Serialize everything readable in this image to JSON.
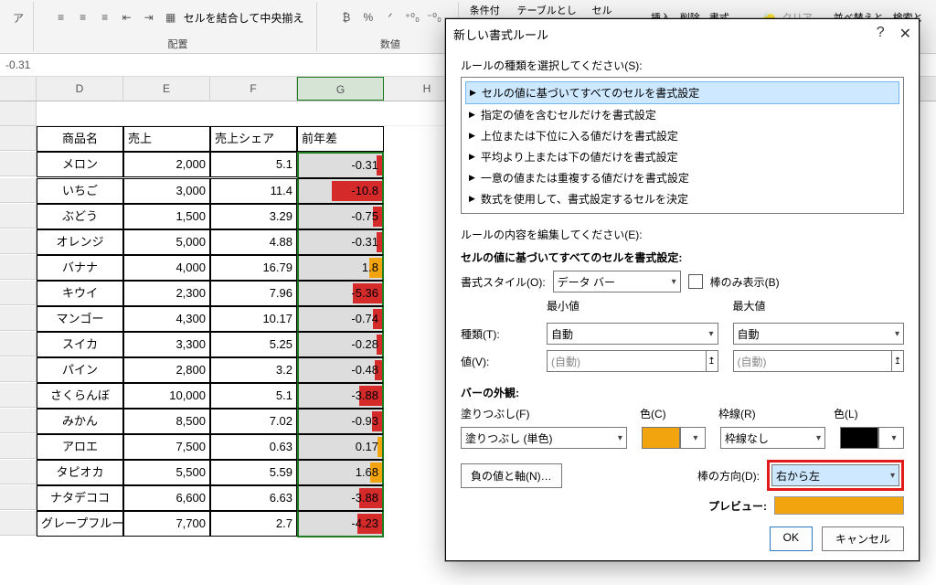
{
  "ribbon": {
    "merge_label": "セルを結合して中央揃え",
    "group_align": "配置",
    "group_number": "数値",
    "percent": "%",
    "comma": "ᐟ",
    "inc_dec": "⁺⁰₀",
    "dec_dec": "⁻⁰₀",
    "cond": "条件付き",
    "tablefmt": "テーブルとして",
    "cellstyle": "セルの",
    "insert": "挿入",
    "delete": "削除",
    "format": "書式",
    "clear": "クリア",
    "sort": "並べ替えと",
    "find": "検索と"
  },
  "formula": "-0.31",
  "columns": {
    "D": "D",
    "E": "E",
    "F": "F",
    "G": "G",
    "H": "H"
  },
  "headers": {
    "name": "商品名",
    "sales": "売上",
    "share": "売上シェア",
    "diff": "前年差"
  },
  "rows": [
    {
      "n": "メロン",
      "s": "2,000",
      "sh": "5.1",
      "d": "-0.31",
      "bw": 6,
      "cls": "red"
    },
    {
      "n": "いちご",
      "s": "3,000",
      "sh": "11.4",
      "d": "-10.8",
      "bw": 55,
      "cls": "red"
    },
    {
      "n": "ぶどう",
      "s": "1,500",
      "sh": "3.29",
      "d": "-0.75",
      "bw": 10,
      "cls": "red"
    },
    {
      "n": "オレンジ",
      "s": "5,000",
      "sh": "4.88",
      "d": "-0.31",
      "bw": 6,
      "cls": "red"
    },
    {
      "n": "バナナ",
      "s": "4,000",
      "sh": "16.79",
      "d": "1.8",
      "bw": 14,
      "cls": "org"
    },
    {
      "n": "キウイ",
      "s": "2,300",
      "sh": "7.96",
      "d": "-5.36",
      "bw": 32,
      "cls": "red"
    },
    {
      "n": "マンゴー",
      "s": "4,300",
      "sh": "10.17",
      "d": "-0.74",
      "bw": 10,
      "cls": "red"
    },
    {
      "n": "スイカ",
      "s": "3,300",
      "sh": "5.25",
      "d": "-0.28",
      "bw": 6,
      "cls": "red"
    },
    {
      "n": "パイン",
      "s": "2,800",
      "sh": "3.2",
      "d": "-0.48",
      "bw": 8,
      "cls": "red"
    },
    {
      "n": "さくらんぼ",
      "s": "10,000",
      "sh": "5.1",
      "d": "-3.88",
      "bw": 25,
      "cls": "red"
    },
    {
      "n": "みかん",
      "s": "8,500",
      "sh": "7.02",
      "d": "-0.93",
      "bw": 11,
      "cls": "red"
    },
    {
      "n": "アロエ",
      "s": "7,500",
      "sh": "0.63",
      "d": "0.17",
      "bw": 5,
      "cls": "org"
    },
    {
      "n": "タピオカ",
      "s": "5,500",
      "sh": "5.59",
      "d": "1.68",
      "bw": 13,
      "cls": "org"
    },
    {
      "n": "ナタデココ",
      "s": "6,600",
      "sh": "6.63",
      "d": "-3.88",
      "bw": 25,
      "cls": "red"
    },
    {
      "n": "グレープフルーツ",
      "s": "7,700",
      "sh": "2.7",
      "d": "-4.23",
      "bw": 27,
      "cls": "red"
    }
  ],
  "dialog": {
    "title": "新しい書式ルール",
    "help": "?",
    "close": "✕",
    "select_rule": "ルールの種類を選択してください(S):",
    "rules": [
      "セルの値に基づいてすべてのセルを書式設定",
      "指定の値を含むセルだけを書式設定",
      "上位または下位に入る値だけを書式設定",
      "平均より上または下の値だけを書式設定",
      "一意の値または重複する値だけを書式設定",
      "数式を使用して、書式設定するセルを決定"
    ],
    "edit_rule": "ルールの内容を編集してください(E):",
    "fmt_all": "セルの値に基づいてすべてのセルを書式設定:",
    "fmt_style": "書式スタイル(O):",
    "databar": "データ バー",
    "bar_only": "棒のみ表示(B)",
    "min": "最小値",
    "max": "最大値",
    "type": "種類(T):",
    "auto": "自動",
    "value": "値(V):",
    "auto_paren": "(自動)",
    "appearance": "バーの外観:",
    "fill": "塗りつぶし(F)",
    "color": "色(C)",
    "border": "枠線(R)",
    "color2": "色(L)",
    "fill_solid": "塗りつぶし (単色)",
    "border_none": "枠線なし",
    "neg_axis": "負の値と軸(N)…",
    "bar_dir": "棒の方向(D):",
    "rtl": "右から左",
    "preview": "プレビュー:",
    "ok": "OK",
    "cancel": "キャンセル"
  }
}
